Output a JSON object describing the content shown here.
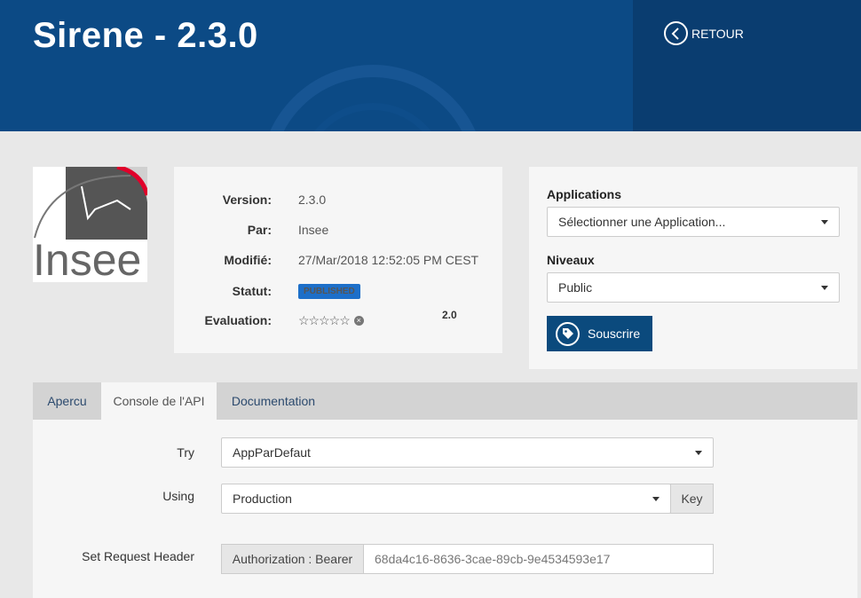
{
  "header": {
    "title": "Sirene - 2.3.0",
    "back_label": "RETOUR"
  },
  "logo": {
    "text": "Insee",
    "icon": "insee-logo"
  },
  "info": {
    "version_label": "Version:",
    "version": "2.3.0",
    "by_label": "Par:",
    "by": "Insee",
    "modified_label": "Modifié:",
    "modified": "27/Mar/2018 12:52:05 PM CEST",
    "status_label": "Statut:",
    "status": "PUBLISHED",
    "rating_label": "Evaluation:",
    "rating_stars": "☆☆☆☆☆",
    "rating_clear": "×",
    "rating_value": "2.0"
  },
  "subscribe": {
    "applications_label": "Applications",
    "applications_selected": "Sélectionner une Application...",
    "levels_label": "Niveaux",
    "levels_selected": "Public",
    "subscribe_label": "Souscrire"
  },
  "tabs": [
    {
      "label": "Apercu",
      "active": false
    },
    {
      "label": "Console de l'API",
      "active": true
    },
    {
      "label": "Documentation",
      "active": false
    }
  ],
  "console": {
    "try_label": "Try",
    "try_selected": "AppParDefaut",
    "using_label": "Using",
    "using_selected": "Production",
    "key_label": "Key",
    "header_label": "Set Request Header",
    "header_prefix": "Authorization : Bearer",
    "header_token": "68da4c16-8636-3cae-89cb-9e4534593e17"
  },
  "colors": {
    "header_bg": "#0c4a85",
    "header_dark": "#0a3d70",
    "accent_button": "#0b4a7d",
    "badge": "#1d6fc9"
  }
}
